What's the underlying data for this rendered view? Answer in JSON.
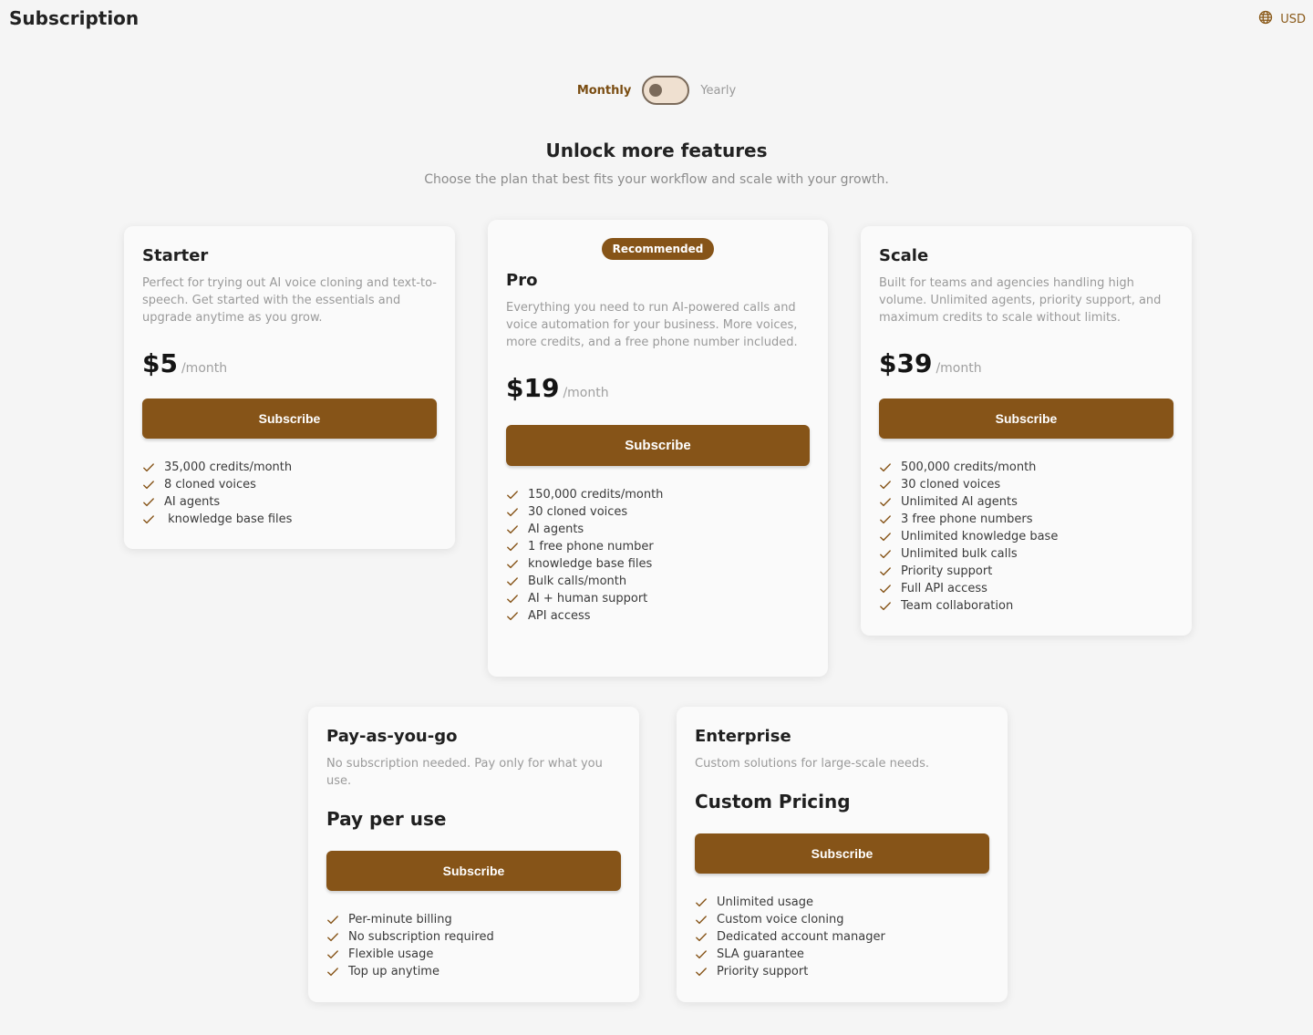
{
  "header": {
    "title": "Subscription",
    "currency": "USD"
  },
  "billing": {
    "monthly_label": "Monthly",
    "yearly_label": "Yearly"
  },
  "intro": {
    "title": "Unlock more features",
    "subtitle": "Choose the plan that best fits your workflow and scale with your growth."
  },
  "plans": {
    "starter": {
      "name": "Starter",
      "description": "Perfect for trying out AI voice cloning and text-to-speech. Get started with the essentials and upgrade anytime as you grow.",
      "price": "$5",
      "period": "/month",
      "cta": "Subscribe",
      "features": [
        "35,000 credits/month",
        "8 cloned voices",
        "AI agents",
        " knowledge base files"
      ]
    },
    "pro": {
      "badge": "Recommended",
      "name": "Pro",
      "description": "Everything you need to run AI-powered calls and voice automation for your business. More voices, more credits, and a free phone number included.",
      "price": "$19",
      "period": "/month",
      "cta": "Subscribe",
      "features": [
        "150,000 credits/month",
        "30 cloned voices",
        "AI agents",
        "1 free phone number",
        "knowledge base files",
        "Bulk calls/month",
        "AI + human support",
        "API access"
      ]
    },
    "scale": {
      "name": "Scale",
      "description": "Built for teams and agencies handling high volume. Unlimited agents, priority support, and maximum credits to scale without limits.",
      "price": "$39",
      "period": "/month",
      "cta": "Subscribe",
      "features": [
        "500,000 credits/month",
        "30 cloned voices",
        "Unlimited AI agents",
        "3 free phone numbers",
        "Unlimited knowledge base",
        "Unlimited bulk calls",
        "Priority support",
        "Full API access",
        "Team collaboration"
      ]
    },
    "payg": {
      "name": "Pay-as-you-go",
      "description": "No subscription needed. Pay only for what you use.",
      "price_label": "Pay per use",
      "cta": "Subscribe",
      "features": [
        "Per-minute billing",
        "No subscription required",
        "Flexible usage",
        "Top up anytime"
      ]
    },
    "enterprise": {
      "name": "Enterprise",
      "description": "Custom solutions for large-scale needs.",
      "price_label": "Custom Pricing",
      "cta": "Subscribe",
      "features": [
        "Unlimited usage",
        "Custom voice cloning",
        "Dedicated account manager",
        "SLA guarantee",
        "Priority support"
      ]
    }
  },
  "icons": {
    "currency": "globe-icon",
    "feature": "check-icon"
  },
  "colors": {
    "accent": "#865418",
    "accent_text": "#7a4d12",
    "background": "#f5f5f5",
    "card": "#fafafa"
  }
}
